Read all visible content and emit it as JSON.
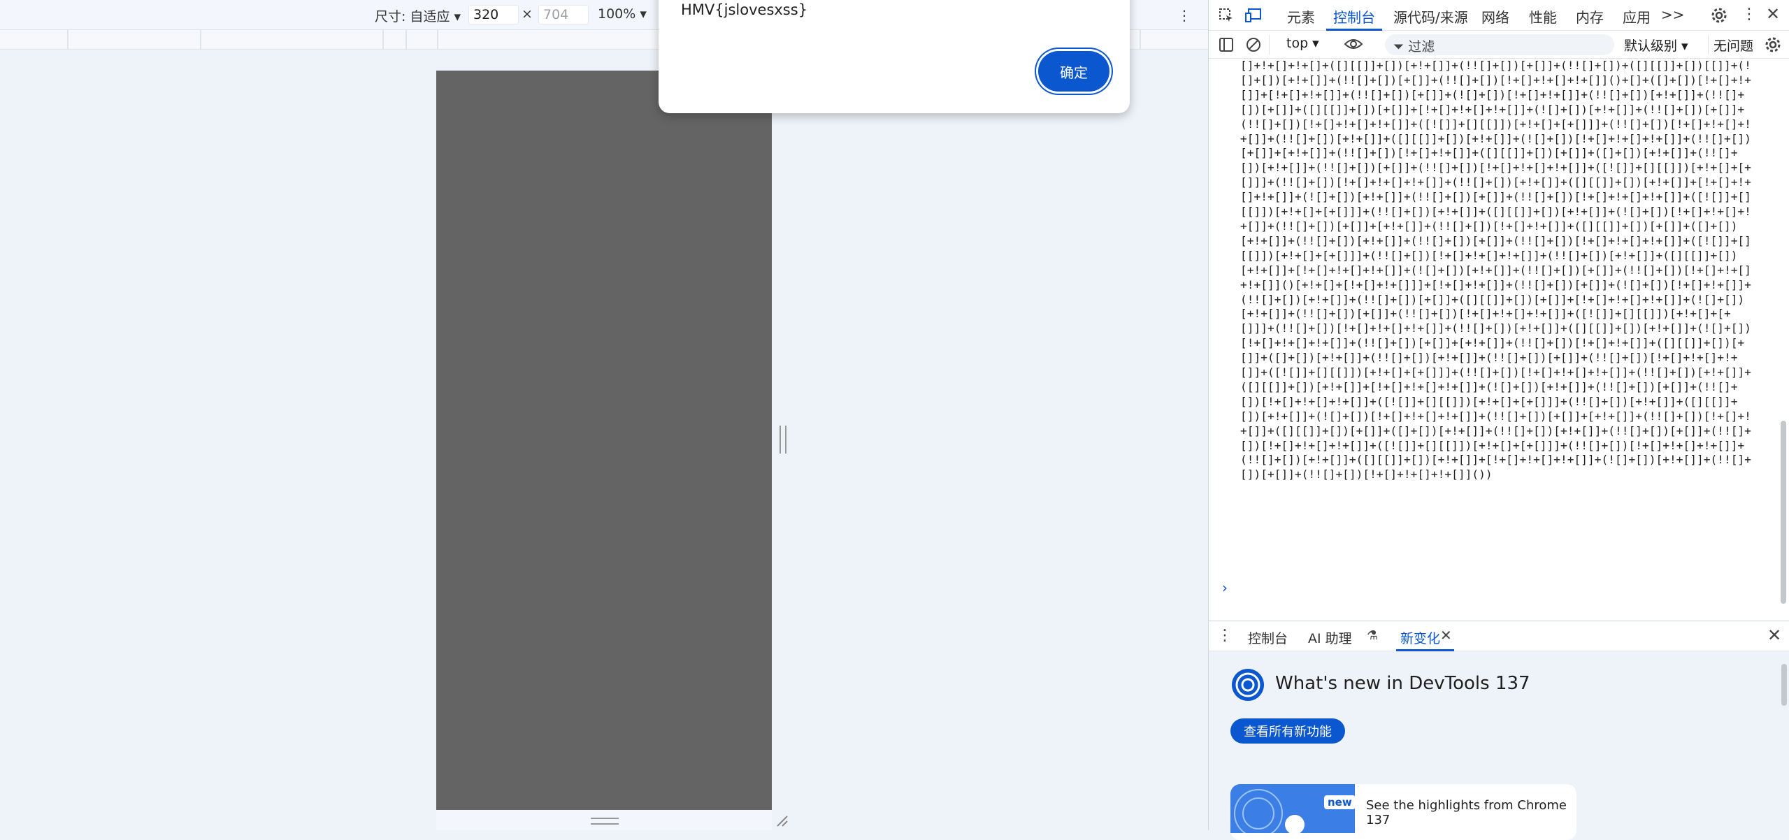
{
  "device_toolbar": {
    "size_label": "尺寸: 自适应",
    "width_value": "320",
    "times": "×",
    "height_placeholder": "704",
    "zoom": "100%"
  },
  "alert": {
    "message": "HMV{jslovesxss}",
    "ok_label": "确定"
  },
  "devtools": {
    "tabs": [
      "元素",
      "控制台",
      "源代码/来源",
      "网络",
      "性能",
      "内存",
      "应用"
    ],
    "active_tab": "控制台",
    "more_tabs": ">>",
    "console_toolbar": {
      "context": "top",
      "filter_placeholder": "过滤",
      "level": "默认级别",
      "issues": "无问题"
    },
    "console_output": "[]+!+[]+!+[]+([][[]]+[])[+!+[]]+(!![]+[])[+[]]+(!![]+[])+([][[]]+[])[[]]+(![]+[])[+!+[]]+(!![]+[])[+[]]+(!![]+[])[!+[]+!+[]+!+[]]()+[]+([]+[])[!+[]+!+[]]+[!+[]+!+[]]+(!![]+[])[+[]]+(![]+[])[!+[]+!+[]]+(!![]+[])[+!+[]]+(!![]+[])[+[]]+([][[]]+[])[+[]]+[!+[]+!+[]+!+[]]+(![]+[])[+!+[]]+(!![]+[])[+[]]+(!![]+[])[!+[]+!+[]+!+[]]+([![]]+[][[]])[+!+[]+[+[]]]+(!![]+[])[!+[]+!+[]+!+[]]+(!![]+[])[+!+[]]+([][[]]+[])[+!+[]]+(![]+[])[!+[]+!+[]+!+[]]+(!![]+[])[+[]]+[+!+[]]+(!![]+[])[!+[]+!+[]]+([][[]]+[])[+[]]+([]+[])[+!+[]]+(!![]+[])[+!+[]]+(!![]+[])[+[]]+(!![]+[])[!+[]+!+[]+!+[]]+([![]]+[][[]])[+!+[]+[+[]]]+(!![]+[])[!+[]+!+[]+!+[]]+(!![]+[])[+!+[]]+([][[]]+[])[+!+[]]+[!+[]+!+[]+!+[]]+(![]+[])[+!+[]]+(!![]+[])[+[]]+(!![]+[])[!+[]+!+[]+!+[]]+([![]]+[][[]])[+!+[]+[+[]]]+(!![]+[])[+!+[]]+([][[]]+[])[+!+[]]+(![]+[])[!+[]+!+[]+!+[]]+(!![]+[])[+[]]+[+!+[]]+(!![]+[])[!+[]+!+[]]+([][[]]+[])[+[]]+([]+[])[+!+[]]+(!![]+[])[+!+[]]+(!![]+[])[+[]]+(!![]+[])[!+[]+!+[]+!+[]]+([![]]+[][[]])[+!+[]+[+[]]]+(!![]+[])[!+[]+!+[]+!+[]]+(!![]+[])[+!+[]]+([][[]]+[])[+!+[]]+[!+[]+!+[]+!+[]]+(![]+[])[+!+[]]+(!![]+[])[+[]]+(!![]+[])[!+[]+!+[]+!+[]]()[+!+[]+[!+[]+!+[]]]+[!+[]+!+[]]+(!![]+[])[+[]]+(![]+[])[!+[]+!+[]]+(!![]+[])[+!+[]]+(!![]+[])[+[]]+([][[]]+[])[+[]]+[!+[]+!+[]+!+[]]+(![]+[])[+!+[]]+(!![]+[])[+[]]+(!![]+[])[!+[]+!+[]+!+[]]+([![]]+[][[]])[+!+[]+[+[]]]+(!![]+[])[!+[]+!+[]+!+[]]+(!![]+[])[+!+[]]+([][[]]+[])[+!+[]]+(![]+[])[!+[]+!+[]+!+[]]+(!![]+[])[+[]]+[+!+[]]+(!![]+[])[!+[]+!+[]]+([][[]]+[])[+[]]+([]+[])[+!+[]]+(!![]+[])[+!+[]]+(!![]+[])[+[]]+(!![]+[])[!+[]+!+[]+!+[]]+([![]]+[][[]])[+!+[]+[+[]]]+(!![]+[])[!+[]+!+[]+!+[]]+(!![]+[])[+!+[]]+([][[]]+[])[+!+[]]+[!+[]+!+[]+!+[]]+(![]+[])[+!+[]]+(!![]+[])[+[]]+(!![]+[])[!+[]+!+[]+!+[]]+([![]]+[][[]])[+!+[]+[+[]]]+(!![]+[])[+!+[]]+([][[]]+[])[+!+[]]+(![]+[])[!+[]+!+[]+!+[]]+(!![]+[])[+[]]+[+!+[]]+(!![]+[])[!+[]+!+[]]+([][[]]+[])[+[]]+([]+[])[+!+[]]+(!![]+[])[+!+[]]+(!![]+[])[+[]]+(!![]+[])[!+[]+!+[]+!+[]]+([![]]+[][[]])[+!+[]+[+[]]]+(!![]+[])[!+[]+!+[]+!+[]]+(!![]+[])[+!+[]]+([][[]]+[])[+!+[]]+[!+[]+!+[]+!+[]]+(![]+[])[+!+[]]+(!![]+[])[+[]]+(!![]+[])[!+[]+!+[]+!+[]]())",
    "drawer_tabs": [
      "控制台",
      "AI 助理",
      "新变化"
    ],
    "drawer_active": "新变化",
    "whats_new_title": "What's new in DevTools 137",
    "see_all_button": "查看所有新功能",
    "card_badge": "new",
    "card_text": "See the highlights from Chrome 137"
  }
}
